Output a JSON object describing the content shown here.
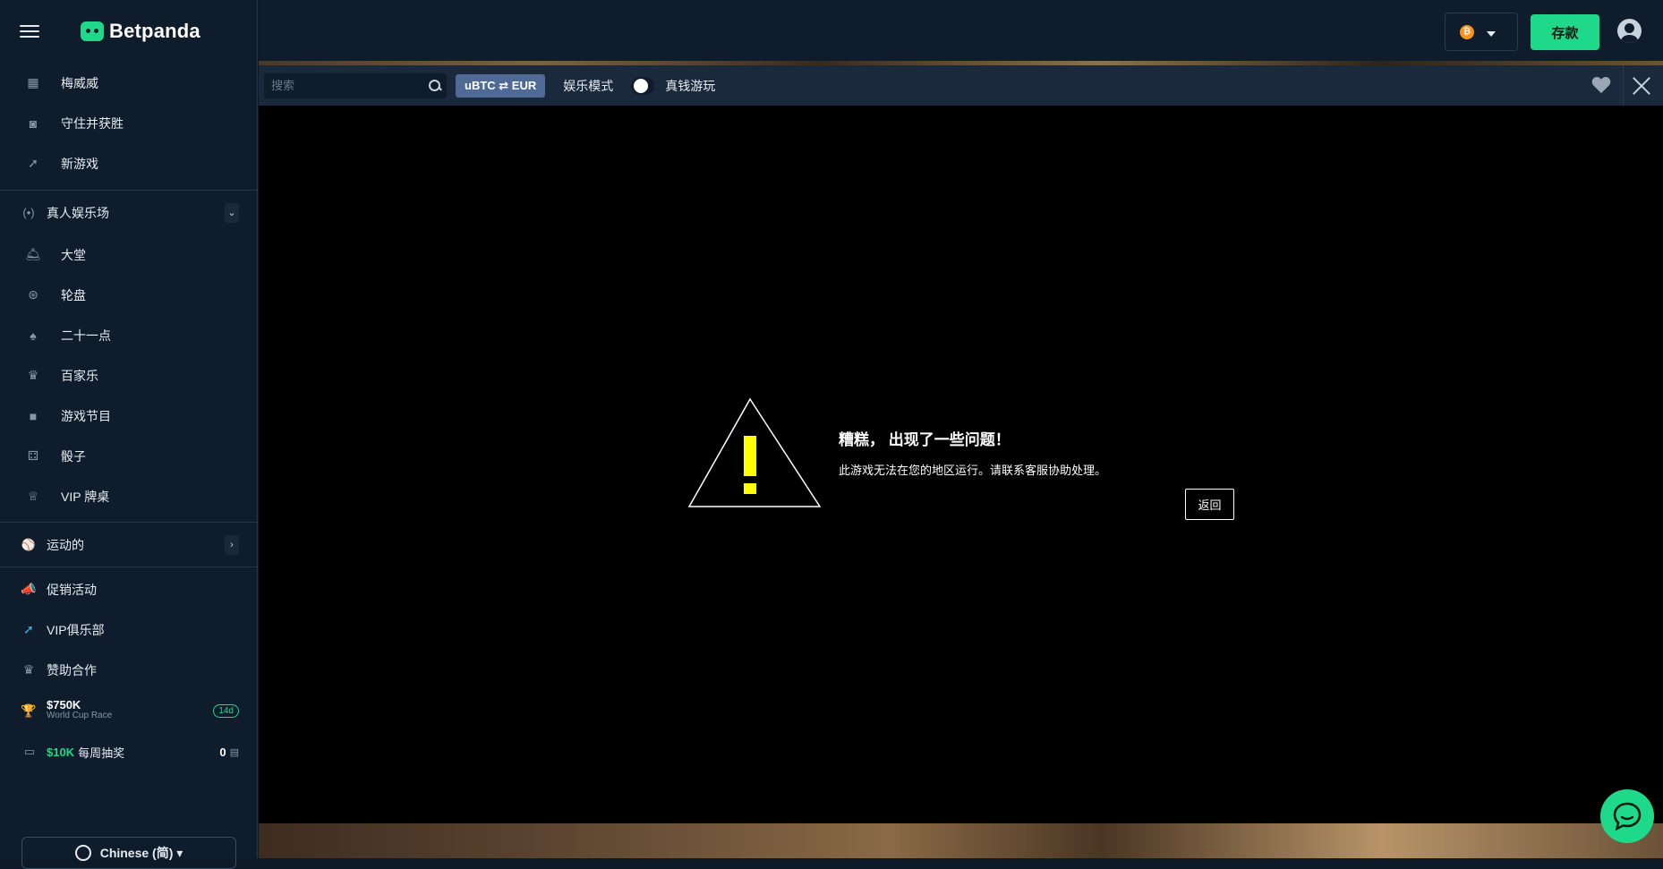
{
  "brand": {
    "name": "Betpanda"
  },
  "sidebar": {
    "top_items": [
      {
        "label": "梅威威",
        "icon": "slot-machine-icon"
      },
      {
        "label": "守住并获胜",
        "icon": "chest-icon"
      },
      {
        "label": "新游戏",
        "icon": "rocket-icon"
      }
    ],
    "live_casino": {
      "label": "真人娱乐场",
      "icon": "broadcast-icon",
      "items": [
        {
          "label": "大堂",
          "icon": "bell-icon"
        },
        {
          "label": "轮盘",
          "icon": "roulette-icon"
        },
        {
          "label": "二十一点",
          "icon": "spade-icon"
        },
        {
          "label": "百家乐",
          "icon": "crown-icon"
        },
        {
          "label": "游戏节目",
          "icon": "camera-icon"
        },
        {
          "label": "骰子",
          "icon": "dice-icon"
        },
        {
          "label": "VIP 牌桌",
          "icon": "vip-crown-icon"
        }
      ]
    },
    "sports": {
      "label": "运动的",
      "icon": "ball-icon"
    },
    "bottom_items": [
      {
        "label": "促销活动",
        "icon": "megaphone-icon"
      },
      {
        "label": "VIP俱乐部",
        "icon": "rocket-icon"
      },
      {
        "label": "赞助合作",
        "icon": "crown-icon"
      }
    ],
    "race": {
      "amount": "$750K",
      "name": "World Cup Race",
      "badge": "14d"
    },
    "draw": {
      "amount": "$10K",
      "label": "每周抽奖",
      "count": "0"
    },
    "language": "Chinese (简) ▾"
  },
  "topbar": {
    "currency_symbol": "₿",
    "deposit_label": "存款"
  },
  "gamebar": {
    "search_placeholder": "搜索",
    "conversion_label": "uBTC ⇄ EUR",
    "fun_mode_label": "娱乐模式",
    "real_mode_label": "真钱游玩"
  },
  "error": {
    "title": "糟糕， 出现了一些问题！",
    "message": "此游戏无法在您的地区运行。请联系客服协助处理。",
    "back_label": "返回"
  },
  "colors": {
    "accent": "#1fd98a",
    "background": "#0f1c2b",
    "warning": "#ffff00"
  }
}
